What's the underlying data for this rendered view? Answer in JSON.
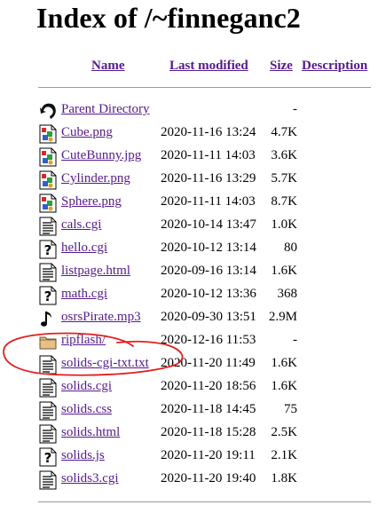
{
  "page": {
    "title": "Index of /~finneganc2"
  },
  "columns": {
    "name": "Name",
    "last_modified": "Last modified",
    "size": "Size",
    "description": "Description"
  },
  "entries": [
    {
      "name": "Parent Directory",
      "date": "",
      "size": "-",
      "icon": "back-arrow-icon"
    },
    {
      "name": "Cube.png",
      "date": "2020-11-16 13:24",
      "size": "4.7K",
      "icon": "image-icon"
    },
    {
      "name": "CuteBunny.jpg",
      "date": "2020-11-11 14:03",
      "size": "3.6K",
      "icon": "image-icon"
    },
    {
      "name": "Cylinder.png",
      "date": "2020-11-16 13:29",
      "size": "5.7K",
      "icon": "image-icon"
    },
    {
      "name": "Sphere.png",
      "date": "2020-11-11 14:03",
      "size": "8.7K",
      "icon": "image-icon"
    },
    {
      "name": "cals.cgi",
      "date": "2020-10-14 13:47",
      "size": "1.0K",
      "icon": "text-file-icon"
    },
    {
      "name": "hello.cgi",
      "date": "2020-10-12 13:14",
      "size": "80",
      "icon": "unknown-file-icon"
    },
    {
      "name": "listpage.html",
      "date": "2020-09-16 13:14",
      "size": "1.6K",
      "icon": "text-file-icon"
    },
    {
      "name": "math.cgi",
      "date": "2020-10-12 13:36",
      "size": "368",
      "icon": "unknown-file-icon"
    },
    {
      "name": "osrsPirate.mp3",
      "date": "2020-09-30 13:51",
      "size": "2.9M",
      "icon": "music-note-icon"
    },
    {
      "name": "ripflash/",
      "date": "2020-12-16 11:53",
      "size": "-",
      "icon": "folder-icon"
    },
    {
      "name": "solids-cgi-txt.txt",
      "date": "2020-11-20 11:49",
      "size": "1.6K",
      "icon": "text-file-icon"
    },
    {
      "name": "solids.cgi",
      "date": "2020-11-20 18:56",
      "size": "1.6K",
      "icon": "text-file-icon"
    },
    {
      "name": "solids.css",
      "date": "2020-11-18 14:45",
      "size": "75",
      "icon": "text-file-icon"
    },
    {
      "name": "solids.html",
      "date": "2020-11-18 15:28",
      "size": "2.5K",
      "icon": "text-file-icon"
    },
    {
      "name": "solids.js",
      "date": "2020-11-20 19:11",
      "size": "2.1K",
      "icon": "unknown-file-icon"
    },
    {
      "name": "solids3.cgi",
      "date": "2020-11-20 19:40",
      "size": "1.8K",
      "icon": "text-file-icon"
    }
  ],
  "colors": {
    "link": "#551a8b",
    "annotation": "#e0201e",
    "rule": "#9a9a9a"
  }
}
